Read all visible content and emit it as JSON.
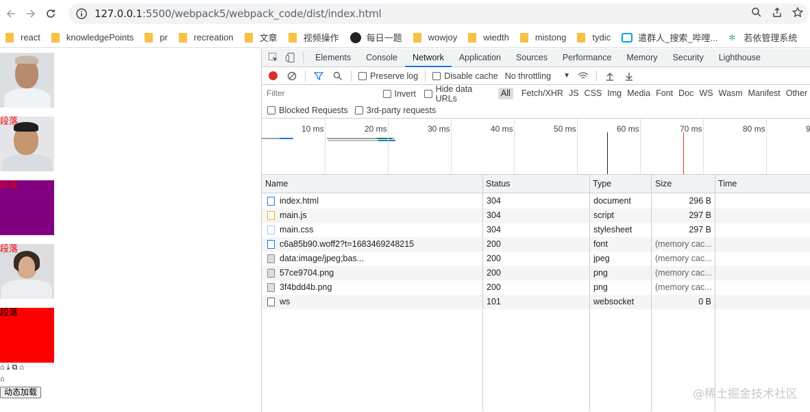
{
  "browser": {
    "url_host": "127.0.0.1",
    "url_rest": ":5500/webpack5/webpack_code/dist/index.html"
  },
  "bookmarks": [
    {
      "label": "react",
      "icon": "folder-icon"
    },
    {
      "label": "knowledgePoints",
      "icon": "folder-icon"
    },
    {
      "label": "pr",
      "icon": "folder-icon"
    },
    {
      "label": "recreation",
      "icon": "folder-icon"
    },
    {
      "label": "文章",
      "icon": "folder-icon"
    },
    {
      "label": "视频操作",
      "icon": "folder-icon"
    },
    {
      "label": "每日一题",
      "icon": "github-icon"
    },
    {
      "label": "wowjoy",
      "icon": "folder-icon"
    },
    {
      "label": "wiedth",
      "icon": "folder-icon"
    },
    {
      "label": "mistong",
      "icon": "folder-icon"
    },
    {
      "label": "tydic",
      "icon": "folder-icon"
    },
    {
      "label": "遣群人_搜索_哔哩...",
      "icon": "bilibili-icon"
    },
    {
      "label": "若依管理系统",
      "icon": "ruoyi-icon"
    }
  ],
  "page": {
    "paragraph_label": "段落",
    "button_label": "动态加载",
    "icons_row": [
      "⌂",
      "⤓",
      "⧉",
      "⌂"
    ],
    "home_icon": "⌂"
  },
  "devtools": {
    "tabs": [
      "Elements",
      "Console",
      "Network",
      "Application",
      "Sources",
      "Performance",
      "Memory",
      "Security",
      "Lighthouse"
    ],
    "active_tab": "Network",
    "toolbar": {
      "preserve_log": "Preserve log",
      "disable_cache": "Disable cache",
      "throttling": "No throttling"
    },
    "filter": {
      "placeholder": "Filter",
      "invert": "Invert",
      "hide_data_urls": "Hide data URLs",
      "types": [
        "All",
        "Fetch/XHR",
        "JS",
        "CSS",
        "Img",
        "Media",
        "Font",
        "Doc",
        "WS",
        "Wasm",
        "Manifest",
        "Other"
      ],
      "active_type": "All",
      "blocked_requests": "Blocked Requests",
      "third_party": "3rd-party requests"
    },
    "timeline_ticks": [
      "10 ms",
      "20 ms",
      "30 ms",
      "40 ms",
      "50 ms",
      "60 ms",
      "70 ms",
      "80 ms",
      "9"
    ],
    "columns": [
      "Name",
      "Status",
      "Type",
      "Size",
      "Time"
    ],
    "rows": [
      {
        "name": "index.html",
        "status": "304",
        "type": "document",
        "size": "296 B",
        "icon": "document-icon"
      },
      {
        "name": "main.js",
        "status": "304",
        "type": "script",
        "size": "297 B",
        "icon": "script-icon"
      },
      {
        "name": "main.css",
        "status": "304",
        "type": "stylesheet",
        "size": "297 B",
        "icon": "stylesheet-icon"
      },
      {
        "name": "c6a85b90.woff2?t=1683469248215",
        "status": "200",
        "type": "font",
        "size": "(memory cac...",
        "icon": "font-icon"
      },
      {
        "name": "data:image/jpeg;bas...",
        "status": "200",
        "type": "jpeg",
        "size": "(memory cac...",
        "icon": "image-icon"
      },
      {
        "name": "57ce9704.png",
        "status": "200",
        "type": "png",
        "size": "(memory cac...",
        "icon": "image-icon"
      },
      {
        "name": "3f4bdd4b.png",
        "status": "200",
        "type": "png",
        "size": "(memory cac...",
        "icon": "image-icon"
      },
      {
        "name": "ws",
        "status": "101",
        "type": "websocket",
        "size": "0 B",
        "icon": "websocket-icon"
      }
    ]
  },
  "watermark": "@稀土掘金技术社区"
}
